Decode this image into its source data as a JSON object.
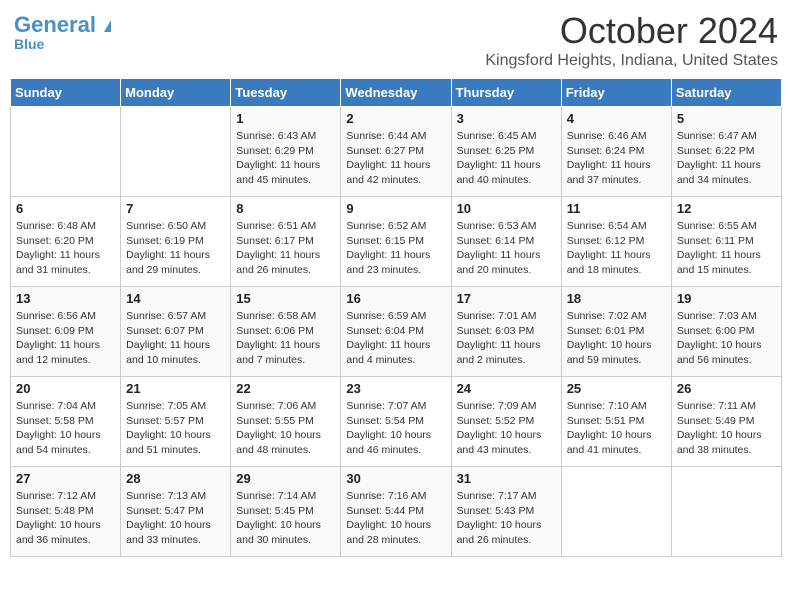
{
  "header": {
    "logo_general": "General",
    "logo_blue": "Blue",
    "title": "October 2024",
    "location": "Kingsford Heights, Indiana, United States"
  },
  "days_of_week": [
    "Sunday",
    "Monday",
    "Tuesday",
    "Wednesday",
    "Thursday",
    "Friday",
    "Saturday"
  ],
  "weeks": [
    [
      {
        "day": "",
        "info": ""
      },
      {
        "day": "",
        "info": ""
      },
      {
        "day": "1",
        "info": "Sunrise: 6:43 AM\nSunset: 6:29 PM\nDaylight: 11 hours and 45 minutes."
      },
      {
        "day": "2",
        "info": "Sunrise: 6:44 AM\nSunset: 6:27 PM\nDaylight: 11 hours and 42 minutes."
      },
      {
        "day": "3",
        "info": "Sunrise: 6:45 AM\nSunset: 6:25 PM\nDaylight: 11 hours and 40 minutes."
      },
      {
        "day": "4",
        "info": "Sunrise: 6:46 AM\nSunset: 6:24 PM\nDaylight: 11 hours and 37 minutes."
      },
      {
        "day": "5",
        "info": "Sunrise: 6:47 AM\nSunset: 6:22 PM\nDaylight: 11 hours and 34 minutes."
      }
    ],
    [
      {
        "day": "6",
        "info": "Sunrise: 6:48 AM\nSunset: 6:20 PM\nDaylight: 11 hours and 31 minutes."
      },
      {
        "day": "7",
        "info": "Sunrise: 6:50 AM\nSunset: 6:19 PM\nDaylight: 11 hours and 29 minutes."
      },
      {
        "day": "8",
        "info": "Sunrise: 6:51 AM\nSunset: 6:17 PM\nDaylight: 11 hours and 26 minutes."
      },
      {
        "day": "9",
        "info": "Sunrise: 6:52 AM\nSunset: 6:15 PM\nDaylight: 11 hours and 23 minutes."
      },
      {
        "day": "10",
        "info": "Sunrise: 6:53 AM\nSunset: 6:14 PM\nDaylight: 11 hours and 20 minutes."
      },
      {
        "day": "11",
        "info": "Sunrise: 6:54 AM\nSunset: 6:12 PM\nDaylight: 11 hours and 18 minutes."
      },
      {
        "day": "12",
        "info": "Sunrise: 6:55 AM\nSunset: 6:11 PM\nDaylight: 11 hours and 15 minutes."
      }
    ],
    [
      {
        "day": "13",
        "info": "Sunrise: 6:56 AM\nSunset: 6:09 PM\nDaylight: 11 hours and 12 minutes."
      },
      {
        "day": "14",
        "info": "Sunrise: 6:57 AM\nSunset: 6:07 PM\nDaylight: 11 hours and 10 minutes."
      },
      {
        "day": "15",
        "info": "Sunrise: 6:58 AM\nSunset: 6:06 PM\nDaylight: 11 hours and 7 minutes."
      },
      {
        "day": "16",
        "info": "Sunrise: 6:59 AM\nSunset: 6:04 PM\nDaylight: 11 hours and 4 minutes."
      },
      {
        "day": "17",
        "info": "Sunrise: 7:01 AM\nSunset: 6:03 PM\nDaylight: 11 hours and 2 minutes."
      },
      {
        "day": "18",
        "info": "Sunrise: 7:02 AM\nSunset: 6:01 PM\nDaylight: 10 hours and 59 minutes."
      },
      {
        "day": "19",
        "info": "Sunrise: 7:03 AM\nSunset: 6:00 PM\nDaylight: 10 hours and 56 minutes."
      }
    ],
    [
      {
        "day": "20",
        "info": "Sunrise: 7:04 AM\nSunset: 5:58 PM\nDaylight: 10 hours and 54 minutes."
      },
      {
        "day": "21",
        "info": "Sunrise: 7:05 AM\nSunset: 5:57 PM\nDaylight: 10 hours and 51 minutes."
      },
      {
        "day": "22",
        "info": "Sunrise: 7:06 AM\nSunset: 5:55 PM\nDaylight: 10 hours and 48 minutes."
      },
      {
        "day": "23",
        "info": "Sunrise: 7:07 AM\nSunset: 5:54 PM\nDaylight: 10 hours and 46 minutes."
      },
      {
        "day": "24",
        "info": "Sunrise: 7:09 AM\nSunset: 5:52 PM\nDaylight: 10 hours and 43 minutes."
      },
      {
        "day": "25",
        "info": "Sunrise: 7:10 AM\nSunset: 5:51 PM\nDaylight: 10 hours and 41 minutes."
      },
      {
        "day": "26",
        "info": "Sunrise: 7:11 AM\nSunset: 5:49 PM\nDaylight: 10 hours and 38 minutes."
      }
    ],
    [
      {
        "day": "27",
        "info": "Sunrise: 7:12 AM\nSunset: 5:48 PM\nDaylight: 10 hours and 36 minutes."
      },
      {
        "day": "28",
        "info": "Sunrise: 7:13 AM\nSunset: 5:47 PM\nDaylight: 10 hours and 33 minutes."
      },
      {
        "day": "29",
        "info": "Sunrise: 7:14 AM\nSunset: 5:45 PM\nDaylight: 10 hours and 30 minutes."
      },
      {
        "day": "30",
        "info": "Sunrise: 7:16 AM\nSunset: 5:44 PM\nDaylight: 10 hours and 28 minutes."
      },
      {
        "day": "31",
        "info": "Sunrise: 7:17 AM\nSunset: 5:43 PM\nDaylight: 10 hours and 26 minutes."
      },
      {
        "day": "",
        "info": ""
      },
      {
        "day": "",
        "info": ""
      }
    ]
  ]
}
